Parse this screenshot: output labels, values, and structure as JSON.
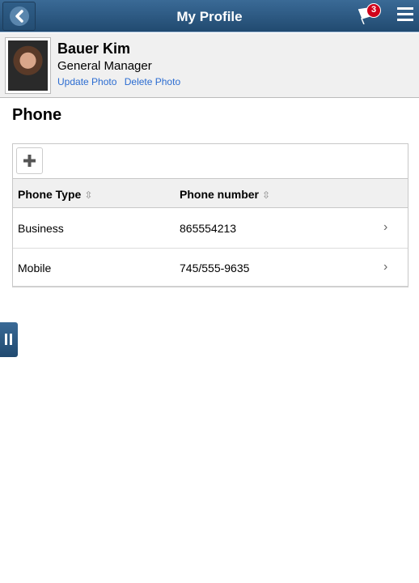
{
  "header": {
    "title": "My Profile",
    "notification_count": "3"
  },
  "profile": {
    "name": "Bauer Kim",
    "job_title": "General Manager",
    "update_photo": "Update Photo",
    "delete_photo": "Delete Photo"
  },
  "section": {
    "title": "Phone"
  },
  "table": {
    "columns": [
      "Phone Type",
      "Phone number"
    ],
    "rows": [
      {
        "type": "Business",
        "number": "865554213"
      },
      {
        "type": "Mobile",
        "number": "745/555-9635"
      }
    ]
  },
  "icons": {
    "sort": "⇳",
    "chevron": "›"
  }
}
